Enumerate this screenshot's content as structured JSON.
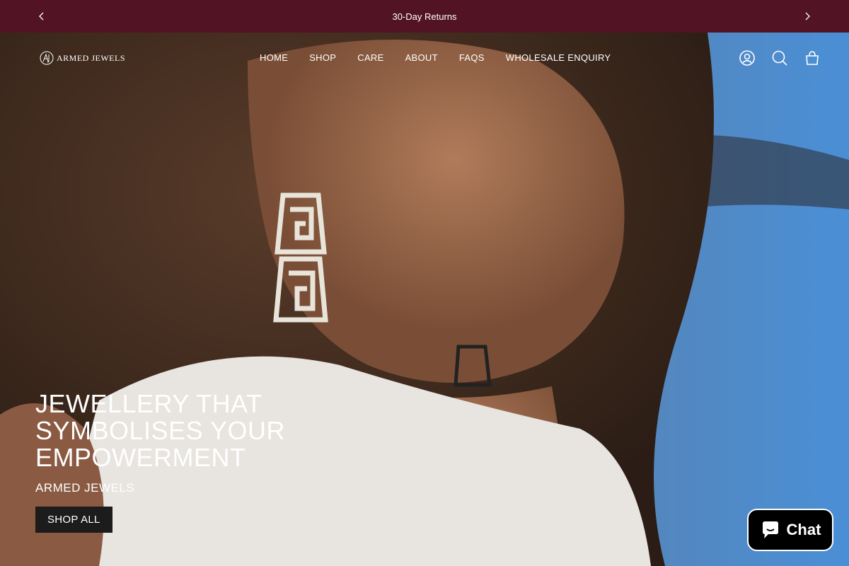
{
  "announcement": {
    "text": "30-Day Returns"
  },
  "header": {
    "logo_text": "ARMED JEWELS",
    "nav": [
      "HOME",
      "SHOP",
      "CARE",
      "ABOUT",
      "FAQS",
      "WHOLESALE ENQUIRY"
    ]
  },
  "hero": {
    "title": "JEWELLERY THAT SYMBOLISES YOUR EMPOWERMENT",
    "subtitle": "ARMED JEWELS",
    "cta": "SHOP ALL"
  },
  "chat": {
    "label": "Chat"
  },
  "colors": {
    "announce_bg": "#521424",
    "button_bg": "#1c1c1c",
    "chat_bg": "#000000"
  },
  "icons": [
    "chevron-left-icon",
    "chevron-right-icon",
    "account-icon",
    "search-icon",
    "cart-icon",
    "chat-bubble-icon"
  ]
}
